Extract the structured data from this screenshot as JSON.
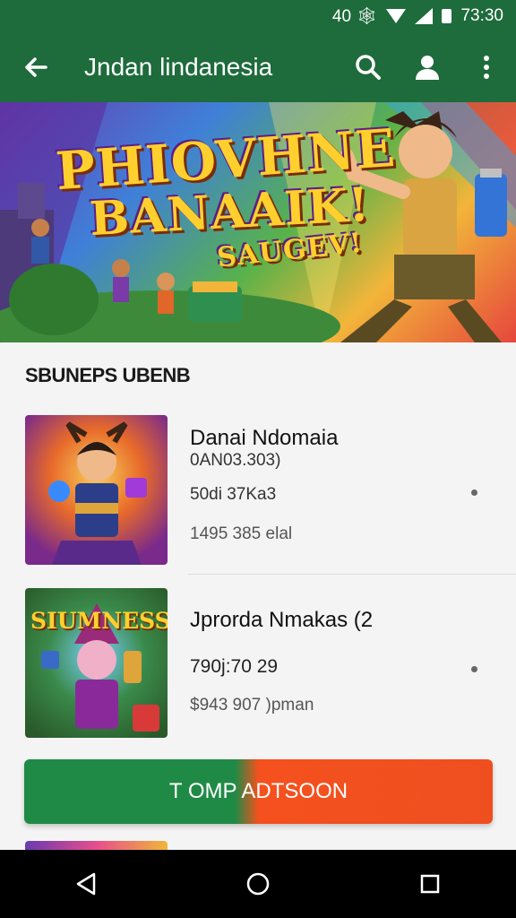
{
  "status_bar": {
    "left_icons": "40 🕸",
    "time": "73:30",
    "wifi_icon": "wifi-icon",
    "signal_icon": "signal-icon",
    "battery_icon": "battery-icon"
  },
  "app_bar": {
    "title": "Jndan lindanesia",
    "back_icon": "back-arrow-icon",
    "search_icon": "search-icon",
    "account_icon": "account-icon",
    "menu_icon": "more-vert-icon"
  },
  "banner": {
    "line1": "PHIOVHNE",
    "line2": "BANAAIK!",
    "line3": "SAUGEV!"
  },
  "section": {
    "title": "SBUNEPS UBENB"
  },
  "items": [
    {
      "name": "Danai Ndomaia",
      "sub": "0AN03.303)",
      "price": "50di 37Ka3",
      "meta": "1495 385 elal"
    },
    {
      "name": "Jprorda Nmakas (2",
      "badge": "SIUMNESS",
      "sub": "790j:70 29",
      "meta": "$943 907 )pman"
    }
  ],
  "cta": {
    "label": "T OMP ADTSOON"
  },
  "colors": {
    "primary": "#1e6b3c",
    "cta_left": "#1f8a45",
    "cta_right": "#f4511e"
  },
  "nav": {
    "back": "nav-back-icon",
    "home": "nav-home-icon",
    "recents": "nav-recents-icon"
  }
}
